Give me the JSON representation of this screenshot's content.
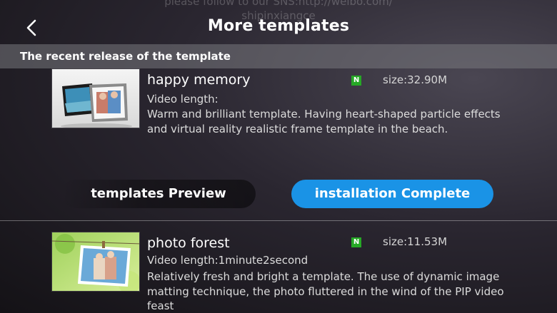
{
  "banner": {
    "line1": "please follow to our SNS:http://weibo.com/",
    "line2": "shipinxiangce"
  },
  "nav": {
    "title": "More templates",
    "back_icon": "chevron-left-icon"
  },
  "section": {
    "title": "The recent release of the template"
  },
  "templates": [
    {
      "name": "happy memory",
      "badge": "N",
      "size": "size:32.90M",
      "video_length": "Video length:",
      "description": "Warm and brilliant template. Having heart-shaped particle effects and virtual reality realistic frame template in the beach."
    },
    {
      "name": "photo forest",
      "badge": "N",
      "size": "size:11.53M",
      "video_length": "Video length:1minute2second",
      "description": "Relatively fresh and bright a template. The use of dynamic image matting technique, the photo fluttered in the wind of the PIP video feast"
    }
  ],
  "actions": {
    "preview_label": "templates Preview",
    "install_label": "installation Complete"
  },
  "colors": {
    "accent": "#1a93e6",
    "badge": "#26a926"
  }
}
